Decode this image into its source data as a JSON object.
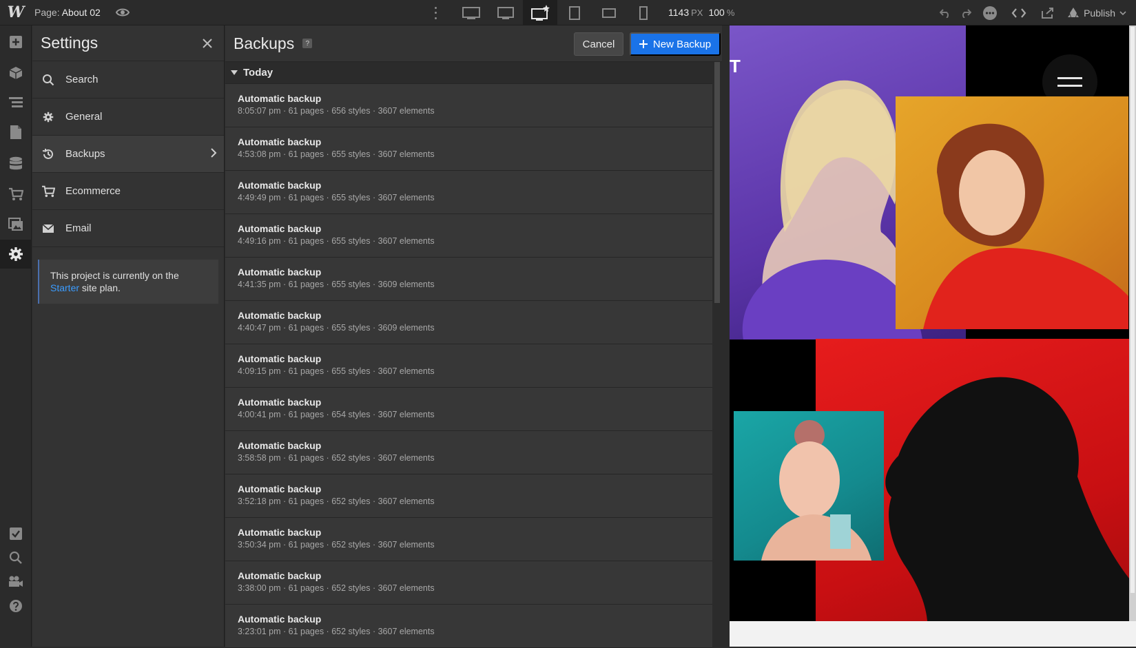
{
  "topbar": {
    "logo": "W",
    "page_prefix": "Page:",
    "page_name": "About 02",
    "width_value": "1143",
    "width_unit": "PX",
    "zoom_value": "100",
    "zoom_unit": "%",
    "publish_label": "Publish"
  },
  "settings": {
    "title": "Settings",
    "items": [
      {
        "label": "Search",
        "icon": "search-icon"
      },
      {
        "label": "General",
        "icon": "gear-icon"
      },
      {
        "label": "Backups",
        "icon": "history-icon"
      },
      {
        "label": "Ecommerce",
        "icon": "cart-icon"
      },
      {
        "label": "Email",
        "icon": "envelope-icon"
      }
    ],
    "plan_text_before": "This project is currently on the ",
    "plan_link": "Starter",
    "plan_text_after": " site plan."
  },
  "backups": {
    "title": "Backups",
    "help": "?",
    "cancel_label": "Cancel",
    "new_label": "New Backup",
    "group_label": "Today",
    "rows": [
      {
        "title": "Automatic backup",
        "meta": "8:05:07 pm · 61 pages · 656 styles · 3607 elements"
      },
      {
        "title": "Automatic backup",
        "meta": "4:53:08 pm · 61 pages · 655 styles · 3607 elements"
      },
      {
        "title": "Automatic backup",
        "meta": "4:49:49 pm · 61 pages · 655 styles · 3607 elements"
      },
      {
        "title": "Automatic backup",
        "meta": "4:49:16 pm · 61 pages · 655 styles · 3607 elements"
      },
      {
        "title": "Automatic backup",
        "meta": "4:41:35 pm · 61 pages · 655 styles · 3609 elements"
      },
      {
        "title": "Automatic backup",
        "meta": "4:40:47 pm · 61 pages · 655 styles · 3609 elements"
      },
      {
        "title": "Automatic backup",
        "meta": "4:09:15 pm · 61 pages · 655 styles · 3607 elements"
      },
      {
        "title": "Automatic backup",
        "meta": "4:00:41 pm · 61 pages · 654 styles · 3607 elements"
      },
      {
        "title": "Automatic backup",
        "meta": "3:58:58 pm · 61 pages · 652 styles · 3607 elements"
      },
      {
        "title": "Automatic backup",
        "meta": "3:52:18 pm · 61 pages · 652 styles · 3607 elements"
      },
      {
        "title": "Automatic backup",
        "meta": "3:50:34 pm · 61 pages · 652 styles · 3607 elements"
      },
      {
        "title": "Automatic backup",
        "meta": "3:38:00 pm · 61 pages · 652 styles · 3607 elements"
      },
      {
        "title": "Automatic backup",
        "meta": "3:23:01 pm · 61 pages · 652 styles · 3607 elements"
      }
    ]
  },
  "preview": {
    "partial_heading": "T"
  },
  "colors": {
    "accent": "#1a73e8",
    "link": "#3b9cff",
    "panel": "#333333",
    "toolbar": "#2b2b2b"
  }
}
